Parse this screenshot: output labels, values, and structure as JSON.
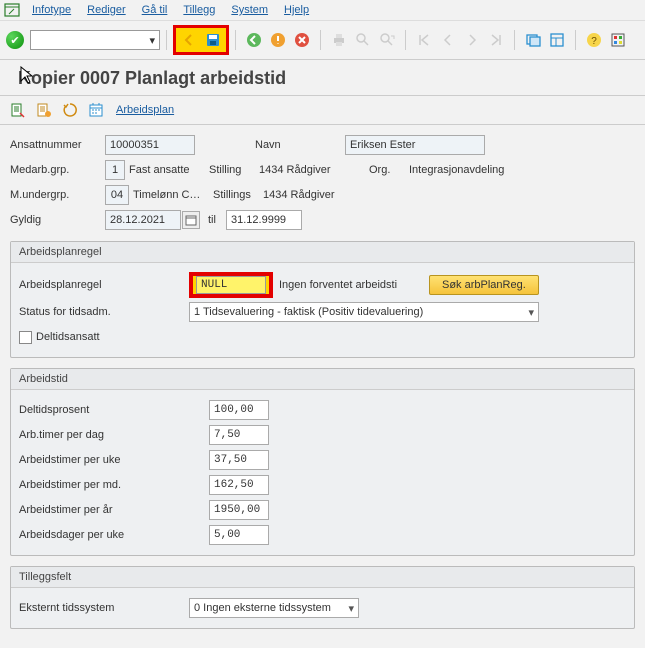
{
  "menu": {
    "items": [
      "Infotype",
      "Rediger",
      "Gå til",
      "Tillegg",
      "System",
      "Hjelp"
    ]
  },
  "title": "Kopier 0007 Planlagt arbeidstid",
  "subtoolbar": {
    "link": "Arbeidsplan"
  },
  "header": {
    "ansattnummer_label": "Ansattnummer",
    "ansattnummer": "10000351",
    "navn_label": "Navn",
    "navn": "Eriksen Ester",
    "medarb_label": "Medarb.grp.",
    "medarb_code": "1",
    "medarb_text": "Fast ansatte",
    "stilling_label": "Stilling",
    "stilling_text": "1434 Rådgiver",
    "org_label": "Org.",
    "org_text": "Integrasjonavdeling",
    "mundergrp_label": "M.undergrp.",
    "mundergrp_code": "04",
    "mundergrp_text": "Timelønn C…",
    "stillings_label": "Stillings",
    "stillings_text": "1434 Rådgiver",
    "gyldig_label": "Gyldig",
    "gyldig_fra": "28.12.2021",
    "til_label": "til",
    "gyldig_til": "31.12.9999"
  },
  "arbeidsplanregel": {
    "group": "Arbeidsplanregel",
    "regel_label": "Arbeidsplanregel",
    "regel_value": "NULL",
    "regel_desc": "Ingen forventet arbeidsti",
    "sok_btn": "Søk arbPlanReg.",
    "status_label": "Status for tidsadm.",
    "status_value": "1  Tidsevaluering - faktisk (Positiv tidevaluering)",
    "deltid_label": "Deltidsansatt"
  },
  "arbeidstid": {
    "group": "Arbeidstid",
    "rows": [
      {
        "label": "Deltidsprosent",
        "value": "100,00"
      },
      {
        "label": "Arb.timer per dag",
        "value": "7,50"
      },
      {
        "label": "Arbeidstimer per uke",
        "value": "37,50"
      },
      {
        "label": "Arbeidstimer per md.",
        "value": "162,50"
      },
      {
        "label": "Arbeidstimer per år",
        "value": "1950,00"
      },
      {
        "label": "Arbeidsdager per uke",
        "value": "5,00"
      }
    ]
  },
  "tillegg": {
    "group": "Tilleggsfelt",
    "eksternt_label": "Eksternt tidssystem",
    "eksternt_value": "0 Ingen eksterne tidssystem"
  }
}
